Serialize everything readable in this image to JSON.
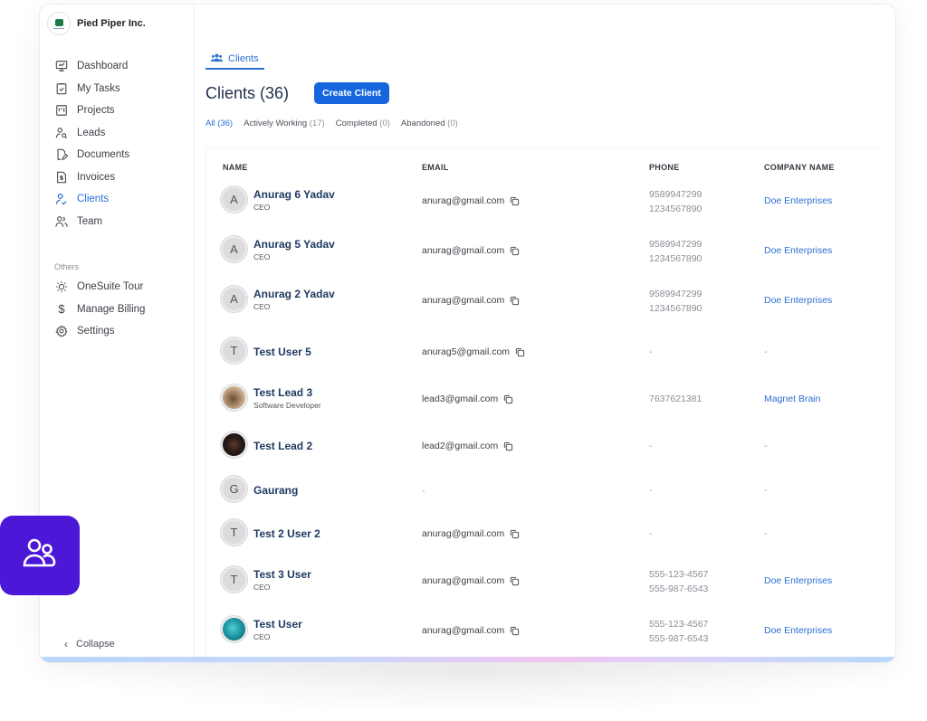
{
  "org": {
    "name": "Pied Piper Inc."
  },
  "sidebar": {
    "items": [
      {
        "label": "Dashboard",
        "icon": "monitor-icon",
        "active": false
      },
      {
        "label": "My Tasks",
        "icon": "checkbox-clipboard-icon",
        "active": false
      },
      {
        "label": "Projects",
        "icon": "kanban-icon",
        "active": false
      },
      {
        "label": "Leads",
        "icon": "user-search-icon",
        "active": false
      },
      {
        "label": "Documents",
        "icon": "document-edit-icon",
        "active": false
      },
      {
        "label": "Invoices",
        "icon": "invoice-icon",
        "active": false
      },
      {
        "label": "Clients",
        "icon": "user-check-icon",
        "active": true
      },
      {
        "label": "Team",
        "icon": "users-icon",
        "active": false
      }
    ],
    "others_label": "Others",
    "others": [
      {
        "label": "OneSuite Tour",
        "icon": "sun-icon"
      },
      {
        "label": "Manage Billing",
        "icon": "dollar-icon"
      },
      {
        "label": "Settings",
        "icon": "gear-icon"
      }
    ],
    "collapse_label": "Collapse"
  },
  "main": {
    "tab_label": "Clients",
    "title": "Clients (36)",
    "create_button": "Create Client",
    "filters": [
      {
        "label": "All",
        "count": "(36)",
        "active": true
      },
      {
        "label": "Actively Working",
        "count": "(17)",
        "active": false
      },
      {
        "label": "Completed",
        "count": "(0)",
        "active": false
      },
      {
        "label": "Abandoned",
        "count": "(0)",
        "active": false
      }
    ],
    "columns": [
      "NAME",
      "EMAIL",
      "PHONE",
      "COMPANY NAME"
    ],
    "rows": [
      {
        "initial": "A",
        "avatar": "initial",
        "name": "Anurag 6 Yadav",
        "role": "CEO",
        "email": "anurag@gmail.com",
        "phones": [
          "9589947299",
          "1234567890"
        ],
        "company": "Doe Enterprises"
      },
      {
        "initial": "A",
        "avatar": "initial",
        "name": "Anurag 5 Yadav",
        "role": "CEO",
        "email": "anurag@gmail.com",
        "phones": [
          "9589947299",
          "1234567890"
        ],
        "company": "Doe Enterprises"
      },
      {
        "initial": "A",
        "avatar": "initial",
        "name": "Anurag 2 Yadav",
        "role": "CEO",
        "email": "anurag@gmail.com",
        "phones": [
          "9589947299",
          "1234567890"
        ],
        "company": "Doe Enterprises"
      },
      {
        "initial": "T",
        "avatar": "initial",
        "name": "Test User 5",
        "role": "",
        "email": "anurag5@gmail.com",
        "phones": [
          "-"
        ],
        "company": "-"
      },
      {
        "initial": "",
        "avatar": "photo1",
        "name": "Test Lead 3",
        "role": "Software Developer",
        "email": "lead3@gmail.com",
        "phones": [
          "7637621381"
        ],
        "company": "Magnet Brain"
      },
      {
        "initial": "",
        "avatar": "photo2",
        "name": "Test Lead 2",
        "role": "",
        "email": "lead2@gmail.com",
        "phones": [
          "-"
        ],
        "company": "-"
      },
      {
        "initial": "G",
        "avatar": "initial",
        "name": "Gaurang",
        "role": "",
        "email": "-",
        "phones": [
          "-"
        ],
        "company": "-"
      },
      {
        "initial": "T",
        "avatar": "initial",
        "name": "Test 2 User 2",
        "role": "",
        "email": "anurag@gmail.com",
        "phones": [
          "-"
        ],
        "company": "-"
      },
      {
        "initial": "T",
        "avatar": "initial",
        "name": "Test 3 User",
        "role": "CEO",
        "email": "anurag@gmail.com",
        "phones": [
          "555-123-4567",
          "555-987-6543"
        ],
        "company": "Doe Enterprises"
      },
      {
        "initial": "",
        "avatar": "photo3",
        "name": "Test User",
        "role": "CEO",
        "email": "anurag@gmail.com",
        "phones": [
          "555-123-4567",
          "555-987-6543"
        ],
        "company": "Doe Enterprises"
      }
    ]
  },
  "colors": {
    "accent": "#2c6fd1",
    "button": "#1566dd",
    "badge": "#4c17d6",
    "name_text": "#1e3a62"
  }
}
